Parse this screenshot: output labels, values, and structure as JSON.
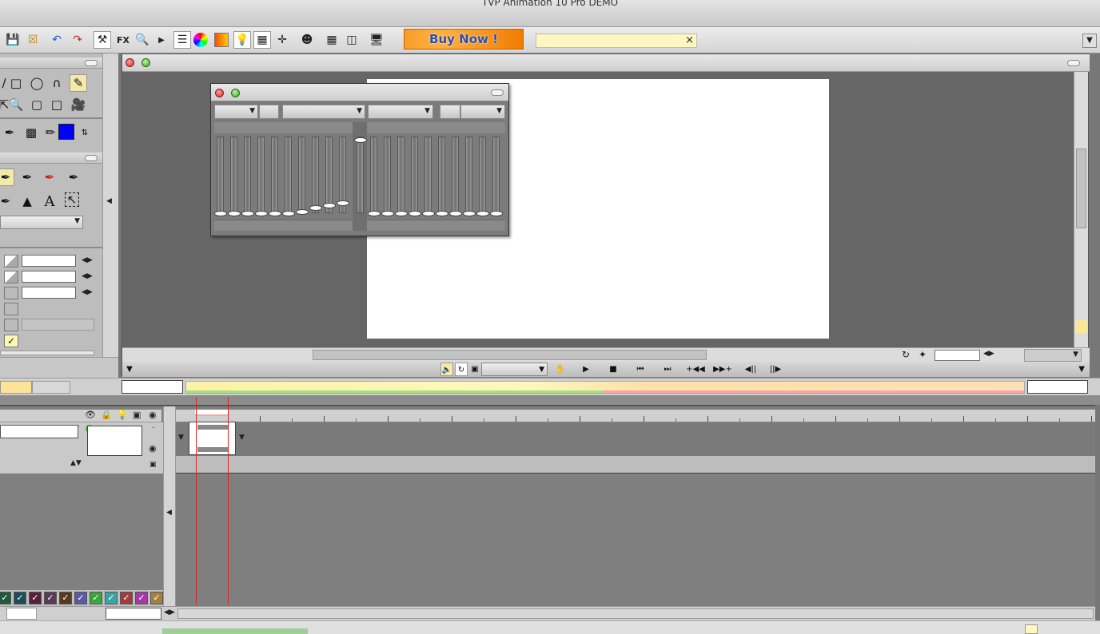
{
  "window": {
    "title": "TVP Animation 10 Pro DEMO"
  },
  "toolbar": {
    "buy_now_label": "Buy Now !",
    "fx_label": "FX",
    "search_close": "×",
    "icons": [
      "save-icon",
      "export-icon",
      "undo-icon",
      "redo-icon",
      "tools-icon",
      "fx-icon",
      "zoom-icon",
      "play-icon",
      "layers-icon",
      "color-wheel-icon",
      "gradient-icon",
      "lightbulb-icon",
      "panel-icon",
      "crosshair-icon",
      "mask-icon",
      "grid-icon",
      "split-icon",
      "monitor-icon"
    ]
  },
  "tools": {
    "text_tool_glyph": "A"
  },
  "colors": {
    "accent_yellow": "#fde39a",
    "primary_color": "#0000ff",
    "buy_now_orange": "#f07c00",
    "timeline_red_line": "#dd2222"
  },
  "palette_swatches": [
    {
      "color": "#1f5a3c"
    },
    {
      "color": "#1c4e5a"
    },
    {
      "color": "#5a1f3a"
    },
    {
      "color": "#5a3a5a"
    },
    {
      "color": "#5a3a1f"
    },
    {
      "color": "#5a5aa5"
    },
    {
      "color": "#3aa53a"
    },
    {
      "color": "#3aa5a5"
    },
    {
      "color": "#a53a3a"
    },
    {
      "color": "#a53aa5"
    },
    {
      "color": "#a5803a"
    }
  ]
}
